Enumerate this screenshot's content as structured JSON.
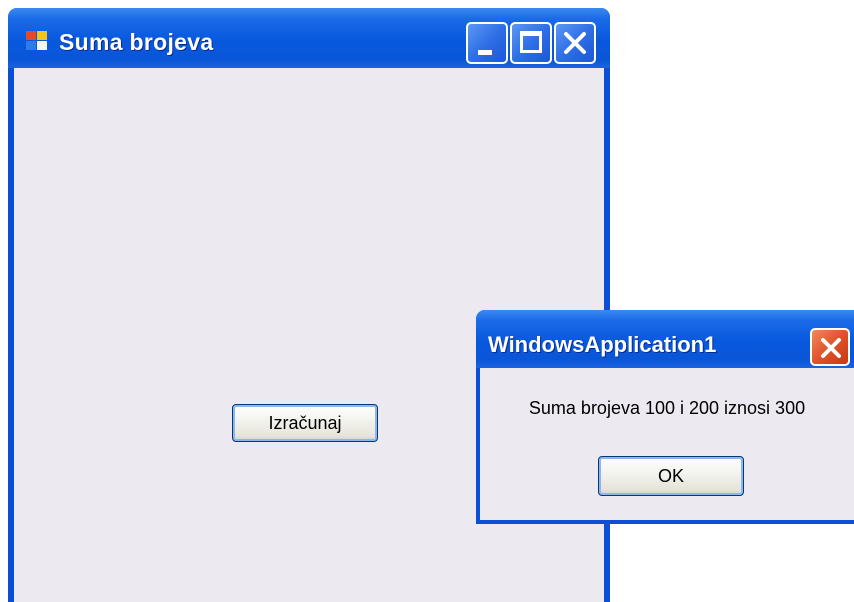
{
  "main_window": {
    "title": "Suma brojeva",
    "calculate_label": "Izračunaj"
  },
  "message_box": {
    "title": "WindowsApplication1",
    "message": "Suma brojeva 100 i 200 iznosi 300",
    "ok_label": "OK"
  },
  "icons": {
    "app": "application-window-icon",
    "minimize": "minimize-icon",
    "maximize": "maximize-icon",
    "close": "close-icon"
  },
  "colors": {
    "titlebar": "#0858de",
    "client": "#ece9f0",
    "close_red": "#e0522a"
  }
}
